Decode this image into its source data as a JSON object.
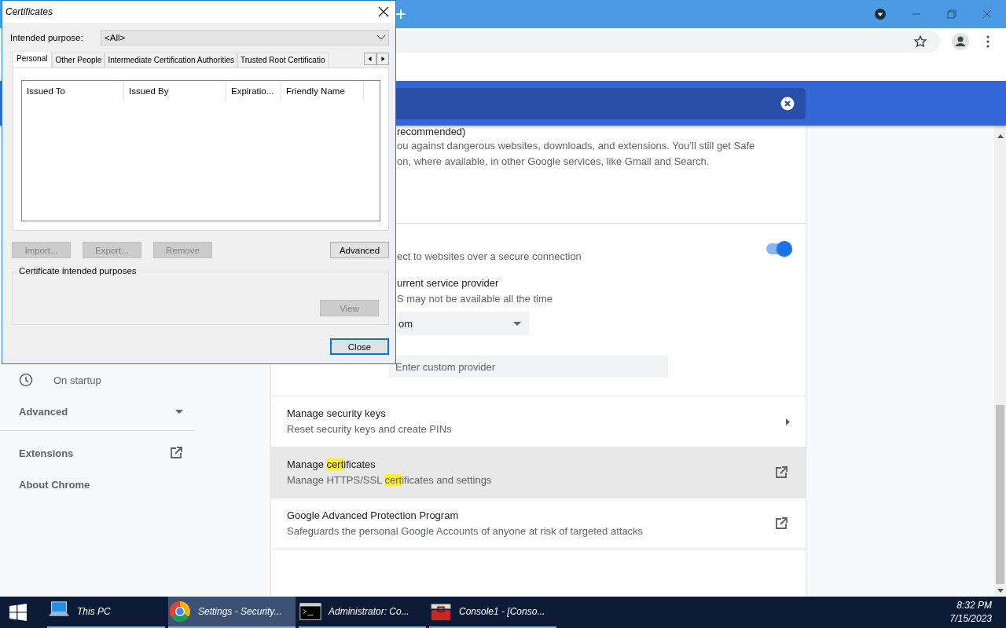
{
  "sidebar": {
    "items": [
      {
        "label": "On startup",
        "kind": "clock"
      },
      {
        "label": "Advanced",
        "kind": "expander"
      },
      {
        "label": "Extensions",
        "kind": "external"
      },
      {
        "label": "About Chrome",
        "kind": "plain"
      }
    ]
  },
  "safe_browsing": {
    "heading": "recommended)",
    "lines": [
      "ou against dangerous websites, downloads, and extensions. You’ll still get Safe",
      "on, where available, in other Google services, like Gmail and Search."
    ]
  },
  "secure_dns": {
    "on": true,
    "description": "ect to websites over a secure connection",
    "option_title": "urrent service provider",
    "option_note": "S may not be available all the time",
    "provider": "om",
    "custom_field": {
      "placeholder": "Enter custom provider"
    }
  },
  "rows": [
    {
      "kind": "arrow",
      "hovered": false,
      "title": [
        {
          "text": "Manage security keys",
          "highlighted": false
        }
      ],
      "subtitle": [
        {
          "text": "Reset security keys and create PINs",
          "highlighted": false
        }
      ]
    },
    {
      "kind": "external",
      "hovered": true,
      "title": [
        {
          "text": "Manage ",
          "highlighted": false
        },
        {
          "text": "cert",
          "highlighted": true
        },
        {
          "text": "ificates",
          "highlighted": false
        }
      ],
      "subtitle": [
        {
          "text": "Manage HTTPS/SSL ",
          "highlighted": false
        },
        {
          "text": "cert",
          "highlighted": true
        },
        {
          "text": "ificates and settings",
          "highlighted": false
        }
      ]
    },
    {
      "kind": "external",
      "hovered": false,
      "title": [
        {
          "text": "Google Advanced Protection Program",
          "highlighted": false
        }
      ],
      "subtitle": [
        {
          "text": "Safeguards the personal Google Accounts of anyone at risk of targeted attacks",
          "highlighted": false
        }
      ]
    }
  ],
  "certificates_dialog": {
    "title": "Certificates",
    "purpose_label": "Intended purpose:",
    "purpose_value": "<All>",
    "tabs": [
      {
        "label": "Personal",
        "selected": true
      },
      {
        "label": "Other People",
        "selected": false
      },
      {
        "label": "Intermediate Certification Authorities",
        "selected": false
      },
      {
        "label": "Trusted Root Certificatio",
        "selected": false
      }
    ],
    "columns": [
      "Issued To",
      "Issued By",
      "Expiratio...",
      "Friendly Name"
    ],
    "buttons": [
      {
        "label": "Import...",
        "disabled": true
      },
      {
        "label": "Export...",
        "disabled": true
      },
      {
        "label": "Remove",
        "disabled": true
      }
    ],
    "advanced_button": {
      "label": "Advanced",
      "disabled": false
    },
    "group_label": "Certificate intended purposes",
    "view_button": {
      "label": "View",
      "disabled": true
    },
    "close_button": {
      "label": "Close",
      "disabled": false
    }
  },
  "taskbar": {
    "items": [
      {
        "label": "This PC",
        "kind": "computer",
        "selected": false
      },
      {
        "label": "Settings - Security...",
        "kind": "browser",
        "selected": true
      },
      {
        "label": "Administrator: Co...",
        "kind": "terminal",
        "selected": false
      },
      {
        "label": "Console1 - [Conso...",
        "kind": "toolbox",
        "selected": false
      }
    ],
    "time": "8:32 PM",
    "date": "7/15/2023"
  }
}
